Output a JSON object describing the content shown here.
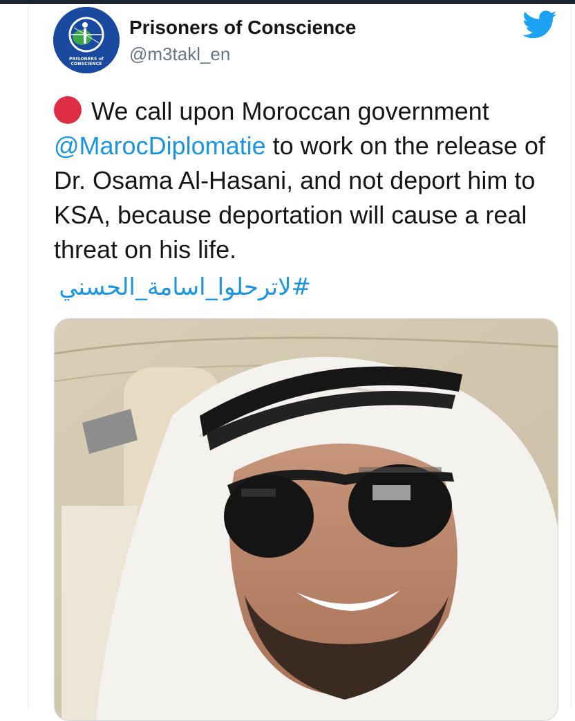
{
  "tweet": {
    "display_name": "Prisoners of Conscience",
    "handle": "@m3takl_en",
    "avatar_caption": "PRISONERS of CONSCIENCE",
    "text_part1": "We call upon Moroccan government",
    "mention": "@MarocDiplomatie",
    "text_part2": " to work on the release of Dr. Osama Al-Hasani, and not deport him to KSA, because deportation will cause a real threat on his life.",
    "hashtag": "#لاترحلوا_اسامة_الحسني"
  },
  "icons": {
    "brand": "twitter-bird-icon",
    "status": "red-circle-emoji"
  },
  "colors": {
    "link": "#1b95e0",
    "twitter_blue": "#1da1f2",
    "avatar_bg": "#1a4aa0",
    "red_circle": "#dd2e44"
  }
}
